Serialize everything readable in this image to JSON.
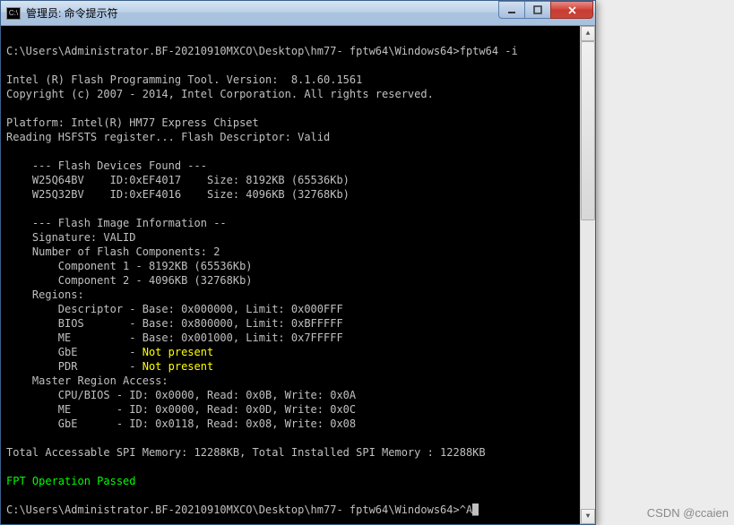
{
  "title": "管理员: 命令提示符",
  "icon_text": "C:\\",
  "console": {
    "path1": "C:\\Users\\Administrator.BF-20210910MXCO\\Desktop\\hm77- fptw64\\Windows64>",
    "cmd1": "fptw64 -i",
    "intel1": "Intel (R) Flash Programming Tool. Version:  8.1.60.1561",
    "intel2": "Copyright (c) 2007 - 2014, Intel Corporation. All rights reserved.",
    "platform": "Platform: Intel(R) HM77 Express Chipset",
    "reading": "Reading HSFSTS register... Flash Descriptor: Valid",
    "fdf": "    --- Flash Devices Found ---",
    "dev1": "    W25Q64BV    ID:0xEF4017    Size: 8192KB (65536Kb)",
    "dev2": "    W25Q32BV    ID:0xEF4016    Size: 4096KB (32768Kb)",
    "fii": "    --- Flash Image Information --",
    "sig": "    Signature: VALID",
    "ncomp": "    Number of Flash Components: 2",
    "comp1": "        Component 1 - 8192KB (65536Kb)",
    "comp2": "        Component 2 - 4096KB (32768Kb)",
    "regions": "    Regions:",
    "rdesc": "        Descriptor - Base: 0x000000, Limit: 0x000FFF",
    "rbios": "        BIOS       - Base: 0x800000, Limit: 0xBFFFFF",
    "rme": "        ME         - Base: 0x001000, Limit: 0x7FFFFF",
    "rgbe_l": "        GbE        - ",
    "rpdr_l": "        PDR        - ",
    "not_present": "Not present",
    "mra": "    Master Region Access:",
    "mcpu": "        CPU/BIOS - ID: 0x0000, Read: 0x0B, Write: 0x0A",
    "mme": "        ME       - ID: 0x0000, Read: 0x0D, Write: 0x0C",
    "mgbe": "        GbE      - ID: 0x0118, Read: 0x08, Write: 0x08",
    "total": "Total Accessable SPI Memory: 12288KB, Total Installed SPI Memory : 12288KB",
    "passed": "FPT Operation Passed",
    "path2": "C:\\Users\\Administrator.BF-20210910MXCO\\Desktop\\hm77- fptw64\\Windows64>",
    "caret": "^A"
  },
  "watermark": "CSDN @ccaien"
}
